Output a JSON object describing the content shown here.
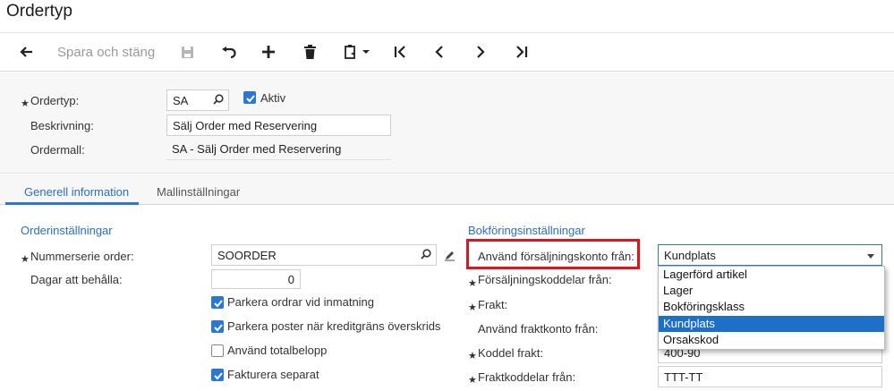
{
  "window": {
    "title": "Ordertyp"
  },
  "toolbar": {
    "save_close_label": "Spara och stäng",
    "icons": [
      "back-arrow-icon",
      "save-icon",
      "undo-icon",
      "add-icon",
      "delete-icon",
      "copy-paste-icon",
      "first-record-icon",
      "previous-icon",
      "next-icon",
      "last-record-icon"
    ]
  },
  "header": {
    "ordertyp_label": "Ordertyp:",
    "ordertyp_value": "SA",
    "aktiv_label": "Aktiv",
    "beskrivning_label": "Beskrivning:",
    "beskrivning_value": "Sälj Order med Reservering",
    "ordermall_label": "Ordermall:",
    "ordermall_value": "SA - Sälj Order med Reservering"
  },
  "tabs": [
    {
      "label": "Generell information",
      "active": true
    },
    {
      "label": "Mallinställningar",
      "active": false
    }
  ],
  "orderinst": {
    "section_title": "Orderinställningar",
    "nummerserie_label": "Nummerserie order:",
    "nummerserie_value": "SOORDER",
    "dagar_label": "Dagar att behålla:",
    "dagar_value": "0",
    "checkboxes": [
      {
        "label": "Parkera ordrar vid inmatning",
        "checked": true
      },
      {
        "label": "Parkera poster när kreditgräns överskrids",
        "checked": true
      },
      {
        "label": "Använd totalbelopp",
        "checked": false
      },
      {
        "label": "Fakturera separat",
        "checked": true
      }
    ]
  },
  "bokf": {
    "section_title": "Bokföringsinställningar",
    "anvand_label": "Använd försäljningskonto från:",
    "anvand_value": "Kundplats",
    "forsaljning_label": "Försäljningskoddelar från:",
    "frakt_label": "Frakt:",
    "fraktkonto_label": "Använd fraktkonto från:",
    "koddel_frakt_label": "Koddel frakt:",
    "koddel_frakt_value": "400-90",
    "fraktkoddelar_label": "Fraktkoddelar från:",
    "fraktkoddelar_value": "TTT-TT",
    "dropdown_options": [
      "Lagerförd artikel",
      "Lager",
      "Bokföringsklass",
      "Kundplats",
      "Orsakskod"
    ],
    "selected_option": "Kundplats"
  },
  "colors": {
    "accent": "#2c77d0",
    "highlight": "#e0141c",
    "selected": "#1e6fc7"
  }
}
